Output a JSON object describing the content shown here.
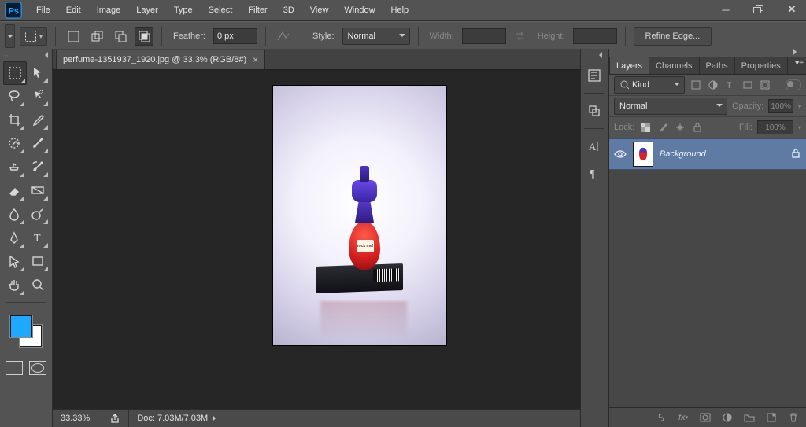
{
  "menu": {
    "items": [
      "File",
      "Edit",
      "Image",
      "Layer",
      "Type",
      "Select",
      "Filter",
      "3D",
      "View",
      "Window",
      "Help"
    ]
  },
  "options": {
    "feather_label": "Feather:",
    "feather_value": "0 px",
    "style_label": "Style:",
    "style_value": "Normal",
    "width_label": "Width:",
    "width_value": "",
    "height_label": "Height:",
    "height_value": "",
    "refine_label": "Refine Edge..."
  },
  "document": {
    "tab_title": "perfume-1351937_1920.jpg @ 33.3% (RGB/8#)",
    "image_label_text": "rock me!"
  },
  "status": {
    "zoom": "33.33%",
    "docsize": "Doc: 7.03M/7.03M"
  },
  "panels": {
    "tabs": [
      "Layers",
      "Channels",
      "Paths",
      "Properties"
    ],
    "filter_kind": "Kind",
    "blend_mode": "Normal",
    "opacity_label": "Opacity:",
    "opacity_value": "100%",
    "lock_label": "Lock:",
    "fill_label": "Fill:",
    "fill_value": "100%",
    "layers": [
      {
        "name": "Background",
        "visible": true,
        "locked": true
      }
    ]
  },
  "colors": {
    "canvas_bg": "#262626",
    "panel_bg": "#535353",
    "accent_selection": "#5f7aa3",
    "foreground_swatch": "#1fa8ff",
    "background_swatch": "#ffffff"
  }
}
